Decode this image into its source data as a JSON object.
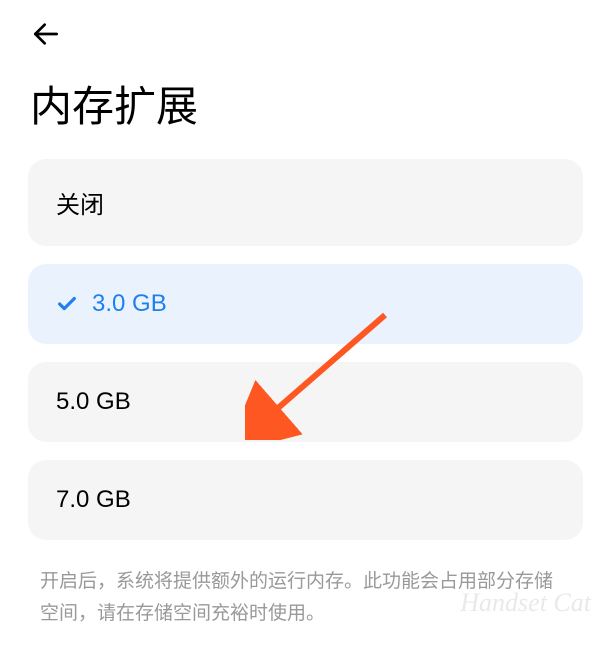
{
  "header": {
    "back_icon": "back-arrow"
  },
  "title": "内存扩展",
  "options": [
    {
      "label": "关闭",
      "selected": false
    },
    {
      "label": "3.0 GB",
      "selected": true
    },
    {
      "label": "5.0 GB",
      "selected": false
    },
    {
      "label": "7.0 GB",
      "selected": false
    }
  ],
  "footer_note": "开启后，系统将提供额外的运行内存。此功能会占用部分存储空间，请在存储空间充裕时使用。",
  "watermark": "Handset Cat"
}
